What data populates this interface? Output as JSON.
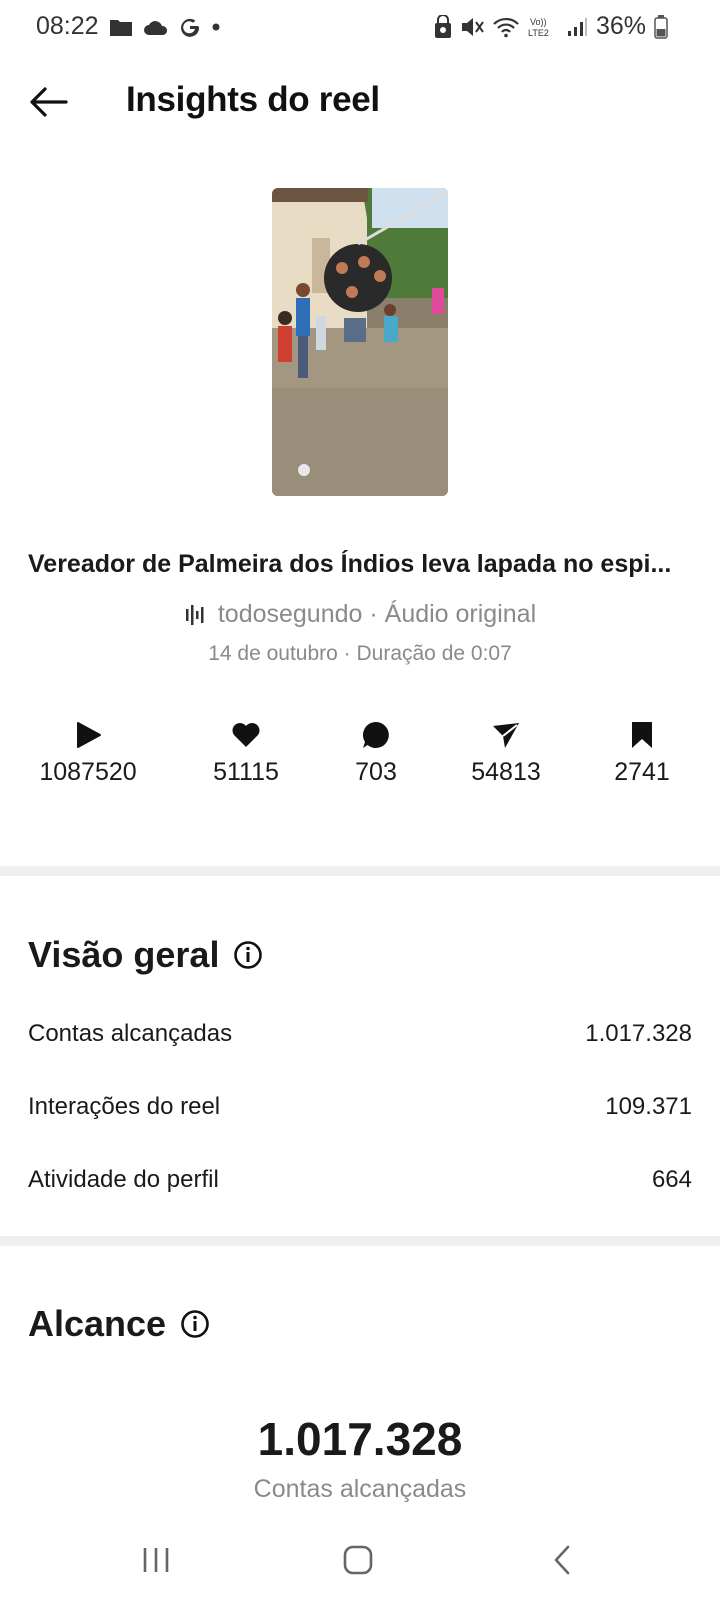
{
  "status_bar": {
    "time": "08:22",
    "battery": "36%"
  },
  "header": {
    "title": "Insights do reel"
  },
  "reel": {
    "caption": "Vereador de Palmeira dos Índios leva lapada no espi...",
    "audio": "todosegundo · Áudio original",
    "meta": "14 de outubro · Duração de 0:07"
  },
  "stats": [
    {
      "icon": "play-icon",
      "value": "1087520"
    },
    {
      "icon": "heart-icon",
      "value": "51115"
    },
    {
      "icon": "comment-icon",
      "value": "703"
    },
    {
      "icon": "share-icon",
      "value": "54813"
    },
    {
      "icon": "bookmark-icon",
      "value": "2741"
    }
  ],
  "overview": {
    "title": "Visão geral",
    "rows": [
      {
        "label": "Contas alcançadas",
        "value": "1.017.328"
      },
      {
        "label": "Interações do reel",
        "value": "109.371"
      },
      {
        "label": "Atividade do perfil",
        "value": "664"
      }
    ]
  },
  "reach": {
    "title": "Alcance",
    "value": "1.017.328",
    "label": "Contas alcançadas"
  }
}
